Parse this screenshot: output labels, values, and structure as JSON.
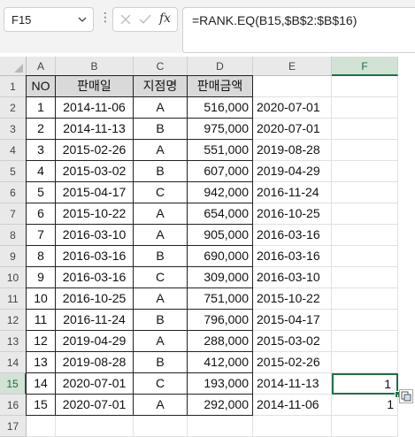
{
  "name_box": {
    "value": "F15"
  },
  "formula_bar": {
    "value": "=RANK.EQ(B15,$B$2:$B$16)"
  },
  "icons": {
    "cancel": "x-icon",
    "enter": "check-icon",
    "function": "fx-icon"
  },
  "columns": [
    "A",
    "B",
    "C",
    "D",
    "E",
    "F"
  ],
  "rows": [
    "1",
    "2",
    "3",
    "4",
    "5",
    "6",
    "7",
    "8",
    "9",
    "10",
    "11",
    "12",
    "13",
    "14",
    "15",
    "16",
    "17"
  ],
  "table": {
    "headers": [
      "NO",
      "판매일",
      "지점명",
      "판매금액"
    ],
    "rows": [
      [
        "1",
        "2014-11-06",
        "A",
        "516,000"
      ],
      [
        "2",
        "2014-11-13",
        "B",
        "975,000"
      ],
      [
        "3",
        "2015-02-26",
        "A",
        "551,000"
      ],
      [
        "4",
        "2015-03-02",
        "B",
        "607,000"
      ],
      [
        "5",
        "2015-04-17",
        "C",
        "942,000"
      ],
      [
        "6",
        "2015-10-22",
        "A",
        "654,000"
      ],
      [
        "7",
        "2016-03-10",
        "A",
        "905,000"
      ],
      [
        "8",
        "2016-03-16",
        "B",
        "690,000"
      ],
      [
        "9",
        "2016-03-16",
        "C",
        "309,000"
      ],
      [
        "10",
        "2016-10-25",
        "A",
        "751,000"
      ],
      [
        "11",
        "2016-11-24",
        "B",
        "796,000"
      ],
      [
        "12",
        "2019-04-29",
        "A",
        "288,000"
      ],
      [
        "13",
        "2019-08-28",
        "B",
        "412,000"
      ],
      [
        "14",
        "2020-07-01",
        "C",
        "193,000"
      ],
      [
        "15",
        "2020-07-01",
        "A",
        "292,000"
      ]
    ]
  },
  "column_e": [
    "2020-07-01",
    "2020-07-01",
    "2019-08-28",
    "2019-04-29",
    "2016-11-24",
    "2016-10-25",
    "2016-03-16",
    "2016-03-16",
    "2016-03-10",
    "2015-10-22",
    "2015-04-17",
    "2015-03-02",
    "2015-02-26",
    "2014-11-13",
    "2014-11-06"
  ],
  "column_f": {
    "15": "1",
    "16": "1"
  },
  "selection": {
    "column": "F",
    "row": "15"
  },
  "colors": {
    "accent": "#1e7145",
    "header_fill": "#d9d9d9"
  }
}
